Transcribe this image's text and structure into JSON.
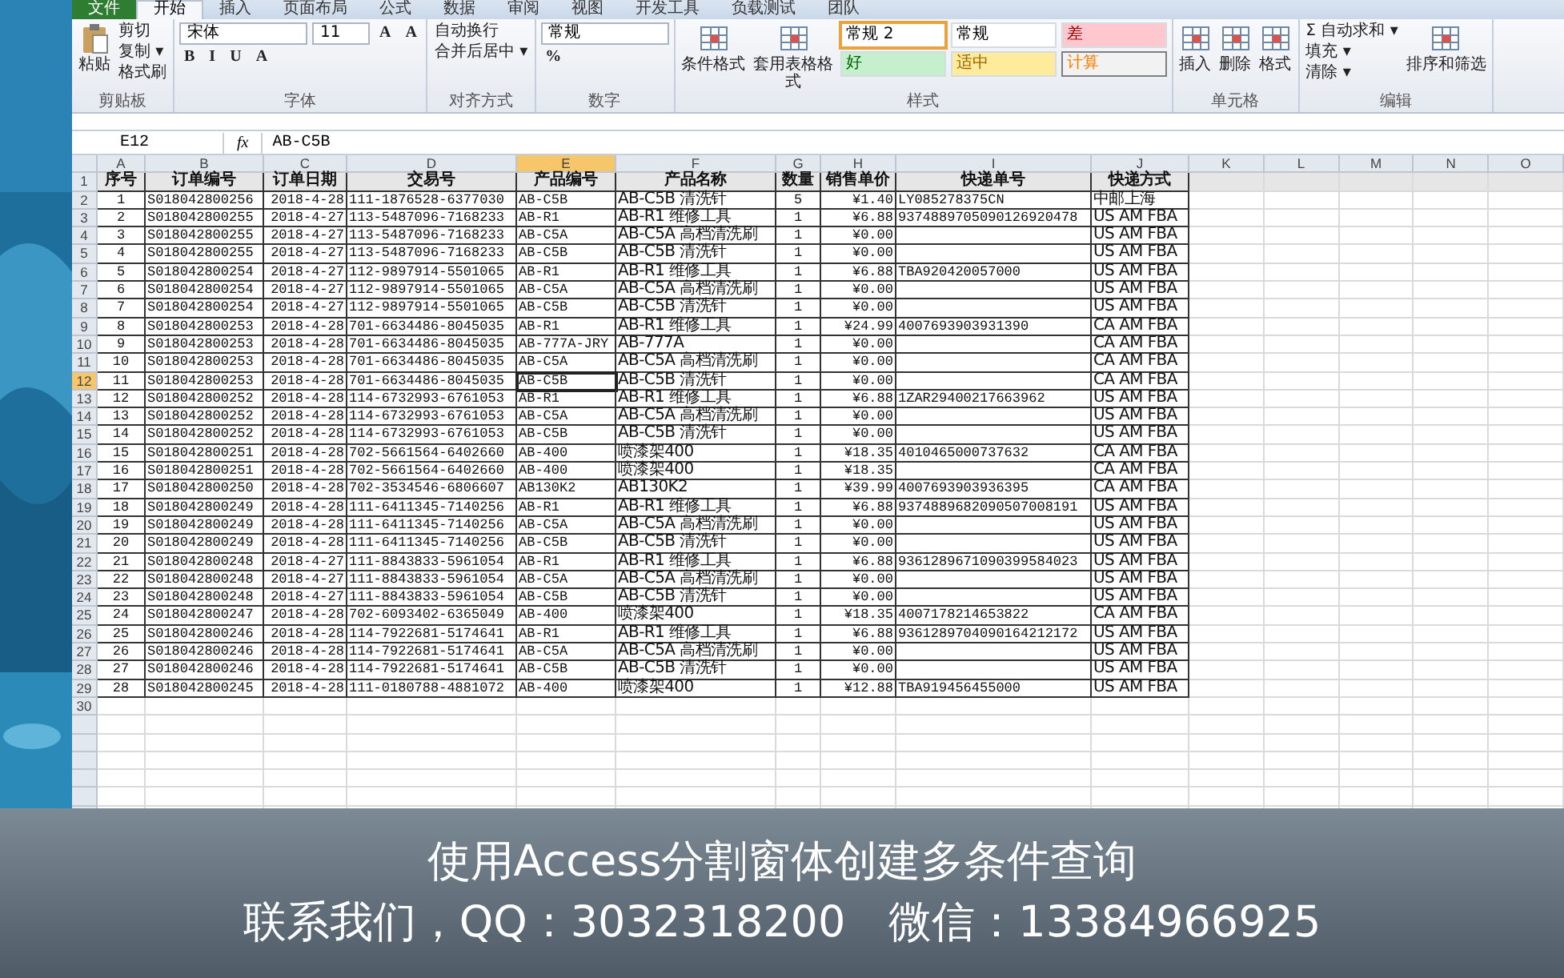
{
  "ribbon": {
    "tabs": [
      {
        "label": "文件",
        "kind": "file",
        "selected": false
      },
      {
        "label": "开始",
        "kind": "tab",
        "selected": true
      },
      {
        "label": "插入",
        "kind": "tab",
        "selected": false
      },
      {
        "label": "页面布局",
        "kind": "tab",
        "selected": false
      },
      {
        "label": "公式",
        "kind": "tab",
        "selected": false
      },
      {
        "label": "数据",
        "kind": "tab",
        "selected": false
      },
      {
        "label": "审阅",
        "kind": "tab",
        "selected": false
      },
      {
        "label": "视图",
        "kind": "tab",
        "selected": false
      },
      {
        "label": "开发工具",
        "kind": "tab",
        "selected": false
      },
      {
        "label": "负载测试",
        "kind": "tab",
        "selected": false
      },
      {
        "label": "团队",
        "kind": "tab",
        "selected": false
      }
    ],
    "groups": [
      {
        "title": "剪贴板",
        "items": [
          {
            "kind": "large",
            "label": "粘贴"
          },
          {
            "kind": "stack",
            "lines": [
              {
                "controls": [
                  {
                    "kind": "small",
                    "label": "剪切"
                  }
                ]
              },
              {
                "controls": [
                  {
                    "kind": "small",
                    "label": "复制 ▾"
                  }
                ]
              },
              {
                "controls": [
                  {
                    "kind": "small",
                    "label": "格式刷"
                  }
                ]
              }
            ]
          }
        ]
      },
      {
        "title": "字体",
        "items": [
          {
            "kind": "stack",
            "lines": [
              {
                "controls": [
                  {
                    "kind": "field",
                    "label": "宋体"
                  },
                  {
                    "kind": "field",
                    "label": "11"
                  },
                  {
                    "kind": "glyph",
                    "label": "A"
                  },
                  {
                    "kind": "glyph",
                    "label": "A"
                  }
                ]
              },
              {
                "controls": [
                  {
                    "kind": "glyph",
                    "label": "B"
                  },
                  {
                    "kind": "glyph",
                    "label": "I"
                  },
                  {
                    "kind": "glyph",
                    "label": "U"
                  },
                  {
                    "kind": "glyph",
                    "label": "A"
                  }
                ]
              }
            ]
          }
        ]
      },
      {
        "title": "对齐方式",
        "items": [
          {
            "kind": "stack",
            "lines": [
              {
                "controls": [
                  {
                    "kind": "small",
                    "label": "自动换行"
                  }
                ]
              },
              {
                "controls": [
                  {
                    "kind": "small",
                    "label": "合并后居中 ▾"
                  }
                ]
              }
            ]
          }
        ]
      },
      {
        "title": "数字",
        "items": [
          {
            "kind": "stack",
            "lines": [
              {
                "controls": [
                  {
                    "kind": "field",
                    "label": "常规"
                  }
                ]
              },
              {
                "controls": [
                  {
                    "kind": "glyph",
                    "label": "%"
                  }
                ]
              }
            ]
          }
        ]
      },
      {
        "title": "样式",
        "items": [
          {
            "kind": "large",
            "label": "条件格式"
          },
          {
            "kind": "large",
            "label": "套用表格格式"
          },
          {
            "kind": "stack",
            "lines": [
              {
                "controls": [
                  {
                    "kind": "normal",
                    "label": "常规 2",
                    "selected": true
                  },
                  {
                    "kind": "normal",
                    "label": "常规",
                    "selected": false
                  },
                  {
                    "kind": "bad",
                    "label": "差",
                    "selected": false
                  }
                ]
              },
              {
                "controls": [
                  {
                    "kind": "good",
                    "label": "好",
                    "selected": false
                  },
                  {
                    "kind": "neutral",
                    "label": "适中",
                    "selected": false
                  },
                  {
                    "kind": "calculation",
                    "label": "计算",
                    "selected": false
                  }
                ]
              }
            ]
          }
        ]
      },
      {
        "title": "单元格",
        "items": [
          {
            "kind": "large",
            "label": "插入"
          },
          {
            "kind": "large",
            "label": "删除"
          },
          {
            "kind": "large",
            "label": "格式"
          }
        ]
      },
      {
        "title": "编辑",
        "items": [
          {
            "kind": "stack",
            "lines": [
              {
                "controls": [
                  {
                    "kind": "small",
                    "label": "Σ 自动求和 ▾"
                  }
                ]
              },
              {
                "controls": [
                  {
                    "kind": "small",
                    "label": "填充 ▾"
                  }
                ]
              },
              {
                "controls": [
                  {
                    "kind": "small",
                    "label": "清除 ▾"
                  }
                ]
              }
            ]
          },
          {
            "kind": "large",
            "label": "排序和筛选"
          }
        ]
      }
    ]
  },
  "formula_bar": {
    "cell_ref": "E12",
    "function_label": "fx",
    "value": "AB-C5B"
  },
  "sheet": {
    "columns": [
      {
        "label": "A",
        "selected": false
      },
      {
        "label": "B",
        "selected": false
      },
      {
        "label": "C",
        "selected": false
      },
      {
        "label": "D",
        "selected": false
      },
      {
        "label": "E",
        "selected": true
      },
      {
        "label": "F",
        "selected": false
      },
      {
        "label": "G",
        "selected": false
      },
      {
        "label": "H",
        "selected": false
      },
      {
        "label": "I",
        "selected": false
      },
      {
        "label": "J",
        "selected": false
      },
      {
        "label": "K",
        "selected": false
      },
      {
        "label": "L",
        "selected": false
      },
      {
        "label": "M",
        "selected": false
      },
      {
        "label": "N",
        "selected": false
      },
      {
        "label": "O",
        "selected": false
      }
    ],
    "rows": [
      {
        "number": "1",
        "kind": "header",
        "selected": false,
        "cells": [
          "序号",
          "订单编号",
          "订单日期",
          "交易号",
          "产品编号",
          "产品名称",
          "数量",
          "销售单价",
          "快递单号",
          "快递方式"
        ]
      },
      {
        "number": "2",
        "kind": "data",
        "selected": false,
        "cells": [
          "1",
          "S018042800256",
          "2018-4-28",
          "111-1876528-6377030",
          "AB-C5B",
          "AB-C5B 清洗针",
          "5",
          "¥1.40",
          "LY085278375CN",
          "中邮上海"
        ]
      },
      {
        "number": "3",
        "kind": "data",
        "selected": false,
        "cells": [
          "2",
          "S018042800255",
          "2018-4-27",
          "113-5487096-7168233",
          "AB-R1",
          "AB-R1 维修工具",
          "1",
          "¥6.88",
          "9374889705090126920478",
          "US AM FBA"
        ]
      },
      {
        "number": "4",
        "kind": "data",
        "selected": false,
        "cells": [
          "3",
          "S018042800255",
          "2018-4-27",
          "113-5487096-7168233",
          "AB-C5A",
          "AB-C5A 高档清洗刷",
          "1",
          "¥0.00",
          null,
          "US AM FBA"
        ]
      },
      {
        "number": "5",
        "kind": "data",
        "selected": false,
        "cells": [
          "4",
          "S018042800255",
          "2018-4-27",
          "113-5487096-7168233",
          "AB-C5B",
          "AB-C5B 清洗针",
          "1",
          "¥0.00",
          null,
          "US AM FBA"
        ]
      },
      {
        "number": "6",
        "kind": "data",
        "selected": false,
        "cells": [
          "5",
          "S018042800254",
          "2018-4-27",
          "112-9897914-5501065",
          "AB-R1",
          "AB-R1 维修工具",
          "1",
          "¥6.88",
          "TBA920420057000",
          "US AM FBA"
        ]
      },
      {
        "number": "7",
        "kind": "data",
        "selected": false,
        "cells": [
          "6",
          "S018042800254",
          "2018-4-27",
          "112-9897914-5501065",
          "AB-C5A",
          "AB-C5A 高档清洗刷",
          "1",
          "¥0.00",
          null,
          "US AM FBA"
        ]
      },
      {
        "number": "8",
        "kind": "data",
        "selected": false,
        "cells": [
          "7",
          "S018042800254",
          "2018-4-27",
          "112-9897914-5501065",
          "AB-C5B",
          "AB-C5B 清洗针",
          "1",
          "¥0.00",
          null,
          "US AM FBA"
        ]
      },
      {
        "number": "9",
        "kind": "data",
        "selected": false,
        "cells": [
          "8",
          "S018042800253",
          "2018-4-28",
          "701-6634486-8045035",
          "AB-R1",
          "AB-R1 维修工具",
          "1",
          "¥24.99",
          "4007693903931390",
          "CA AM FBA"
        ]
      },
      {
        "number": "10",
        "kind": "data",
        "selected": false,
        "cells": [
          "9",
          "S018042800253",
          "2018-4-28",
          "701-6634486-8045035",
          "AB-777A-JRY",
          "AB-777A",
          "1",
          "¥0.00",
          null,
          "CA AM FBA"
        ]
      },
      {
        "number": "11",
        "kind": "data",
        "selected": false,
        "cells": [
          "10",
          "S018042800253",
          "2018-4-28",
          "701-6634486-8045035",
          "AB-C5A",
          "AB-C5A 高档清洗刷",
          "1",
          "¥0.00",
          null,
          "CA AM FBA"
        ]
      },
      {
        "number": "12",
        "kind": "data",
        "selected": true,
        "cells": [
          "11",
          "S018042800253",
          "2018-4-28",
          "701-6634486-8045035",
          "AB-C5B",
          "AB-C5B 清洗针",
          "1",
          "¥0.00",
          null,
          "CA AM FBA"
        ]
      },
      {
        "number": "13",
        "kind": "data",
        "selected": false,
        "cells": [
          "12",
          "S018042800252",
          "2018-4-28",
          "114-6732993-6761053",
          "AB-R1",
          "AB-R1 维修工具",
          "1",
          "¥6.88",
          "1ZAR29400217663962",
          "US AM FBA"
        ]
      },
      {
        "number": "14",
        "kind": "data",
        "selected": false,
        "cells": [
          "13",
          "S018042800252",
          "2018-4-28",
          "114-6732993-6761053",
          "AB-C5A",
          "AB-C5A 高档清洗刷",
          "1",
          "¥0.00",
          null,
          "US AM FBA"
        ]
      },
      {
        "number": "15",
        "kind": "data",
        "selected": false,
        "cells": [
          "14",
          "S018042800252",
          "2018-4-28",
          "114-6732993-6761053",
          "AB-C5B",
          "AB-C5B 清洗针",
          "1",
          "¥0.00",
          null,
          "US AM FBA"
        ]
      },
      {
        "number": "16",
        "kind": "data",
        "selected": false,
        "cells": [
          "15",
          "S018042800251",
          "2018-4-28",
          "702-5661564-6402660",
          "AB-400",
          "喷漆架400",
          "1",
          "¥18.35",
          "4010465000737632",
          "CA AM FBA"
        ]
      },
      {
        "number": "17",
        "kind": "data",
        "selected": false,
        "cells": [
          "16",
          "S018042800251",
          "2018-4-28",
          "702-5661564-6402660",
          "AB-400",
          "喷漆架400",
          "1",
          "¥18.35",
          null,
          "CA AM FBA"
        ]
      },
      {
        "number": "18",
        "kind": "data",
        "selected": false,
        "cells": [
          "17",
          "S018042800250",
          "2018-4-28",
          "702-3534546-6806607",
          "AB130K2",
          "AB130K2",
          "1",
          "¥39.99",
          "4007693903936395",
          "CA AM FBA"
        ]
      },
      {
        "number": "19",
        "kind": "data",
        "selected": false,
        "cells": [
          "18",
          "S018042800249",
          "2018-4-28",
          "111-6411345-7140256",
          "AB-R1",
          "AB-R1 维修工具",
          "1",
          "¥6.88",
          "9374889682090507008191",
          "US AM FBA"
        ]
      },
      {
        "number": "20",
        "kind": "data",
        "selected": false,
        "cells": [
          "19",
          "S018042800249",
          "2018-4-28",
          "111-6411345-7140256",
          "AB-C5A",
          "AB-C5A 高档清洗刷",
          "1",
          "¥0.00",
          null,
          "US AM FBA"
        ]
      },
      {
        "number": "21",
        "kind": "data",
        "selected": false,
        "cells": [
          "20",
          "S018042800249",
          "2018-4-28",
          "111-6411345-7140256",
          "AB-C5B",
          "AB-C5B 清洗针",
          "1",
          "¥0.00",
          null,
          "US AM FBA"
        ]
      },
      {
        "number": "22",
        "kind": "data",
        "selected": false,
        "cells": [
          "21",
          "S018042800248",
          "2018-4-27",
          "111-8843833-5961054",
          "AB-R1",
          "AB-R1 维修工具",
          "1",
          "¥6.88",
          "9361289671090399584023",
          "US AM FBA"
        ]
      },
      {
        "number": "23",
        "kind": "data",
        "selected": false,
        "cells": [
          "22",
          "S018042800248",
          "2018-4-27",
          "111-8843833-5961054",
          "AB-C5A",
          "AB-C5A 高档清洗刷",
          "1",
          "¥0.00",
          null,
          "US AM FBA"
        ]
      },
      {
        "number": "24",
        "kind": "data",
        "selected": false,
        "cells": [
          "23",
          "S018042800248",
          "2018-4-27",
          "111-8843833-5961054",
          "AB-C5B",
          "AB-C5B 清洗针",
          "1",
          "¥0.00",
          null,
          "US AM FBA"
        ]
      },
      {
        "number": "25",
        "kind": "data",
        "selected": false,
        "cells": [
          "24",
          "S018042800247",
          "2018-4-28",
          "702-6093402-6365049",
          "AB-400",
          "喷漆架400",
          "1",
          "¥18.35",
          "4007178214653822",
          "CA AM FBA"
        ]
      },
      {
        "number": "26",
        "kind": "data",
        "selected": false,
        "cells": [
          "25",
          "S018042800246",
          "2018-4-28",
          "114-7922681-5174641",
          "AB-R1",
          "AB-R1 维修工具",
          "1",
          "¥6.88",
          "9361289704090164212172",
          "US AM FBA"
        ]
      },
      {
        "number": "27",
        "kind": "data",
        "selected": false,
        "cells": [
          "26",
          "S018042800246",
          "2018-4-28",
          "114-7922681-5174641",
          "AB-C5A",
          "AB-C5A 高档清洗刷",
          "1",
          "¥0.00",
          null,
          "US AM FBA"
        ]
      },
      {
        "number": "28",
        "kind": "data",
        "selected": false,
        "cells": [
          "27",
          "S018042800246",
          "2018-4-28",
          "114-7922681-5174641",
          "AB-C5B",
          "AB-C5B 清洗针",
          "1",
          "¥0.00",
          null,
          "US AM FBA"
        ]
      },
      {
        "number": "29",
        "kind": "data",
        "selected": false,
        "cells": [
          "28",
          "S018042800245",
          "2018-4-28",
          "111-0180788-4881072",
          "AB-400",
          "喷漆架400",
          "1",
          "¥12.88",
          "TBA919456455000",
          "US AM FBA"
        ]
      },
      {
        "number": "30",
        "kind": "empty",
        "selected": false,
        "cells": []
      }
    ]
  },
  "caption": [
    "使用Access分割窗体创建多条件查询",
    "联系我们，QQ：3032318200　微信：13384966925"
  ]
}
